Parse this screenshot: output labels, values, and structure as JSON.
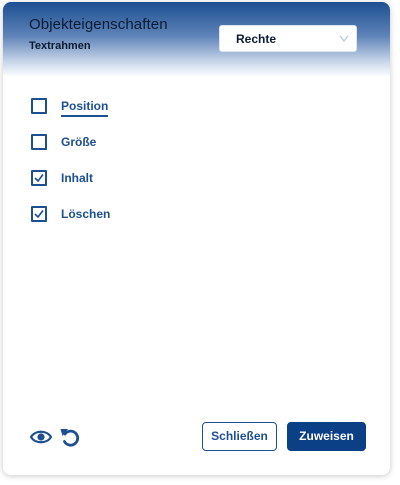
{
  "dialog": {
    "title": "Objekteigenschaften",
    "subtitle": "Textrahmen",
    "select": {
      "value": "Rechte"
    }
  },
  "options": [
    {
      "label": "Position",
      "checked": false,
      "focused": true
    },
    {
      "label": "Größe",
      "checked": false,
      "focused": false
    },
    {
      "label": "Inhalt",
      "checked": true,
      "focused": false
    },
    {
      "label": "Löschen",
      "checked": true,
      "focused": false
    }
  ],
  "footer": {
    "preview_icon": "eye-icon",
    "reset_icon": "undo-icon",
    "close_label": "Schließen",
    "assign_label": "Zuweisen"
  },
  "colors": {
    "accent": "#1d4f91",
    "primary_button": "#0b3f86",
    "text_dark": "#0d1b33"
  }
}
